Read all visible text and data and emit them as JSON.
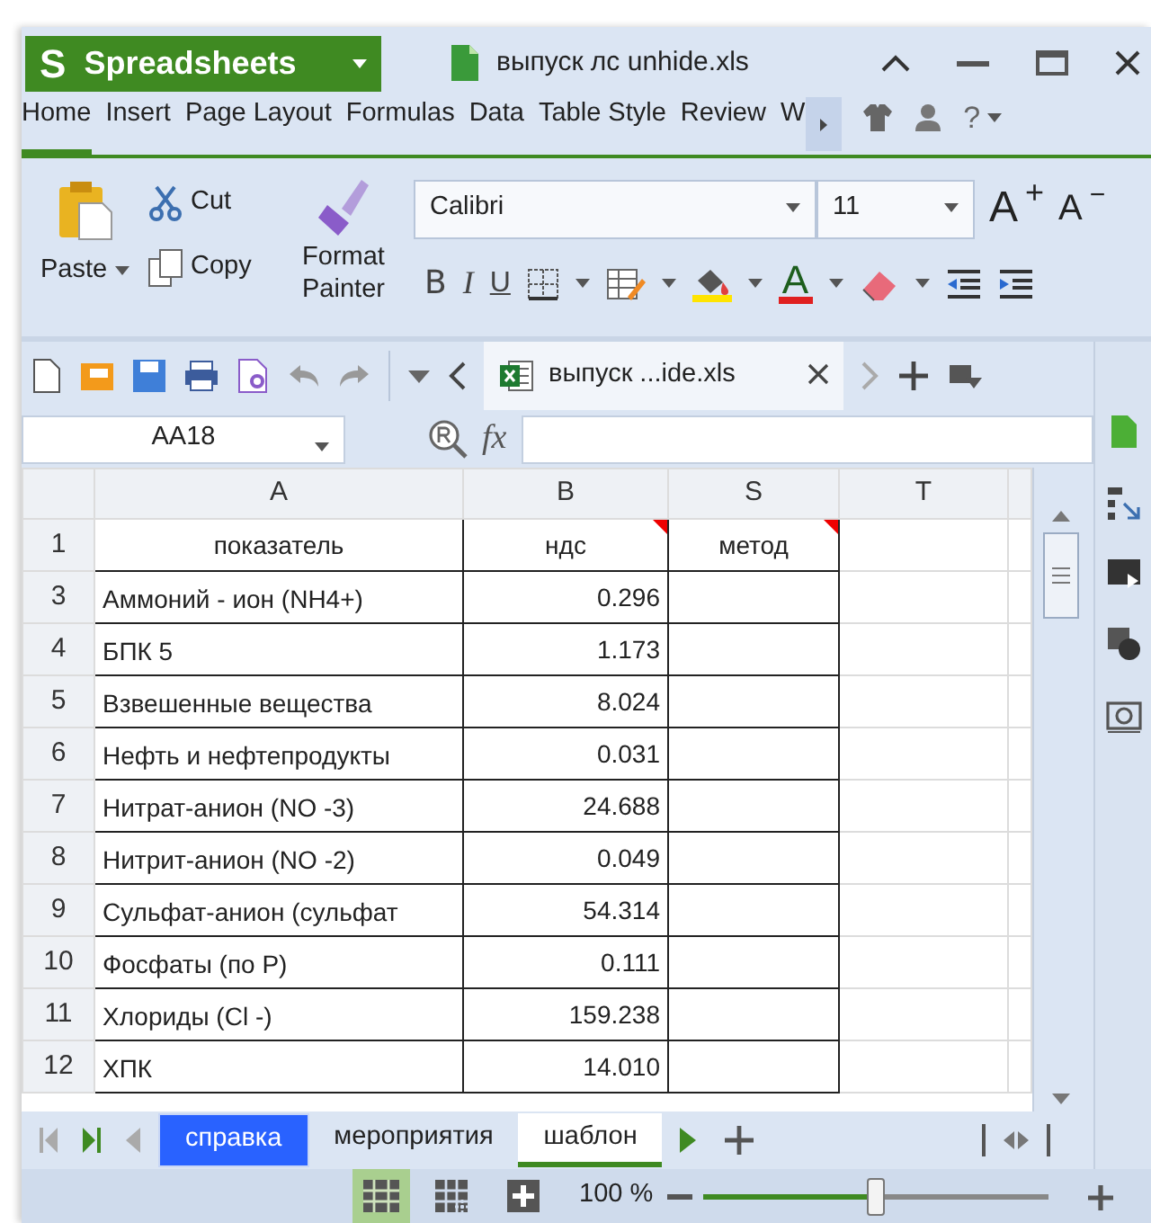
{
  "app_menu": {
    "logo": "S",
    "label": "Spreadsheets"
  },
  "window": {
    "title": "выпуск лс unhide.xls"
  },
  "menu_tabs": [
    {
      "label": "Home",
      "selected": true
    },
    {
      "label": "Insert",
      "selected": false
    },
    {
      "label": "Page Layout",
      "selected": false
    },
    {
      "label": "Formulas",
      "selected": false
    },
    {
      "label": "Data",
      "selected": false
    },
    {
      "label": "Table Style",
      "selected": false
    },
    {
      "label": "Review",
      "selected": false
    },
    {
      "label": "W",
      "selected": false
    }
  ],
  "help": "?",
  "ribbon": {
    "paste": "Paste",
    "cut": "Cut",
    "copy": "Copy",
    "format_painter": "Format Painter",
    "font_name": "Calibri",
    "font_size": "11",
    "grow": "A$^{+}$",
    "shrink": "A$^{−}$",
    "bold": "B",
    "italic": "I",
    "underline": "U",
    "font_color": "A"
  },
  "doc_tab": {
    "label": "выпуск ...ide.xls"
  },
  "name_box": {
    "value": "AA18"
  },
  "formula_label": "fx",
  "grid": {
    "columns": [
      "A",
      "B",
      "S",
      "T"
    ],
    "header_row": {
      "row": "1",
      "cells": [
        {
          "text": "показатель",
          "comment": false
        },
        {
          "text": "ндс",
          "comment": true
        },
        {
          "text": "метод",
          "comment": true
        }
      ]
    },
    "rows": [
      {
        "row": "3",
        "name": "Аммоний - ион (NH4+)",
        "value": "0.296"
      },
      {
        "row": "4",
        "name": "БПК 5",
        "value": "1.173"
      },
      {
        "row": "5",
        "name": "Взвешенные вещества",
        "value": "8.024"
      },
      {
        "row": "6",
        "name": "Нефть и нефтепродукты",
        "value": "0.031"
      },
      {
        "row": "7",
        "name": "Нитрат-анион (NO -3)",
        "value": "24.688"
      },
      {
        "row": "8",
        "name": "Нитрит-анион (NO -2)",
        "value": "0.049"
      },
      {
        "row": "9",
        "name": "Сульфат-анион (сульфат",
        "value": "54.314"
      },
      {
        "row": "10",
        "name": "Фосфаты (по Р)",
        "value": "0.111"
      },
      {
        "row": "11",
        "name": "Хлориды (Cl -)",
        "value": "159.238"
      },
      {
        "row": "12",
        "name": "ХПК",
        "value": "14.010"
      }
    ]
  },
  "sheet_tabs": [
    {
      "label": "справка",
      "selected": false,
      "color": "#2962ff"
    },
    {
      "label": "мероприятия",
      "selected": false
    },
    {
      "label": "шаблон",
      "selected": true
    }
  ],
  "status_bar": {
    "views": [
      {
        "kind": "normal",
        "selected": true
      },
      {
        "kind": "page_break",
        "selected": false
      },
      {
        "kind": "full_screen",
        "selected": false
      }
    ],
    "zoom": "100 %",
    "level": 0.5
  }
}
